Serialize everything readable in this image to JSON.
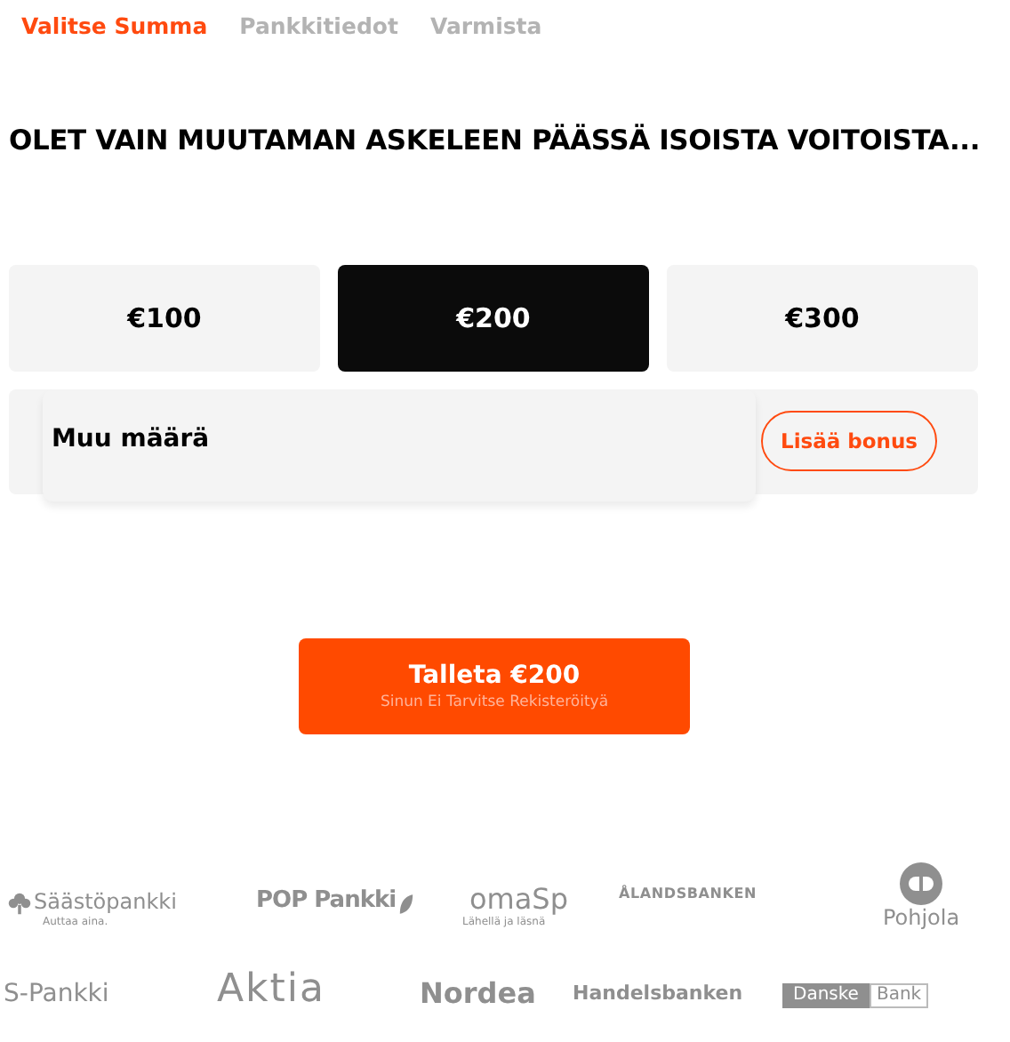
{
  "steps": [
    {
      "label": "Valitse Summa",
      "selected": true
    },
    {
      "label": "Pankkitiedot",
      "selected": false
    },
    {
      "label": "Varmista",
      "selected": false
    }
  ],
  "headline": "OLET VAIN MUUTAMAN ASKELEEN PÄÄSSÄ ISOISTA VOITOISTA...",
  "amounts": [
    {
      "label": "€100",
      "selected": false
    },
    {
      "label": "€200",
      "selected": true
    },
    {
      "label": "€300",
      "selected": false
    }
  ],
  "other_amount": {
    "placeholder": "Muu määrä",
    "bonus_button": "Lisää bonus"
  },
  "deposit_button": {
    "label": "Talleta €200",
    "subtitle": "Sinun Ei Tarvitse Rekisteröityä"
  },
  "bank_logos": [
    {
      "kind": "tree",
      "name": "Säästöpankki",
      "tagline": "Auttaa aina."
    },
    {
      "kind": "leaf",
      "name": "POP Pankki"
    },
    {
      "kind": "tagline",
      "name": "omaSp",
      "tagline": "Lähellä ja läsnä"
    },
    {
      "kind": "caps",
      "name": "ÅLANDSBANKEN"
    },
    {
      "kind": "emblem",
      "name": "Pohjola"
    },
    {
      "kind": "plain",
      "name": "S-Pankki"
    },
    {
      "kind": "large",
      "name": "Aktia"
    },
    {
      "kind": "rounded",
      "name": "Nordea"
    },
    {
      "kind": "plain",
      "name": "Handelsbanken"
    },
    {
      "kind": "split",
      "name": "Danske",
      "name_2": "Bank"
    }
  ]
}
